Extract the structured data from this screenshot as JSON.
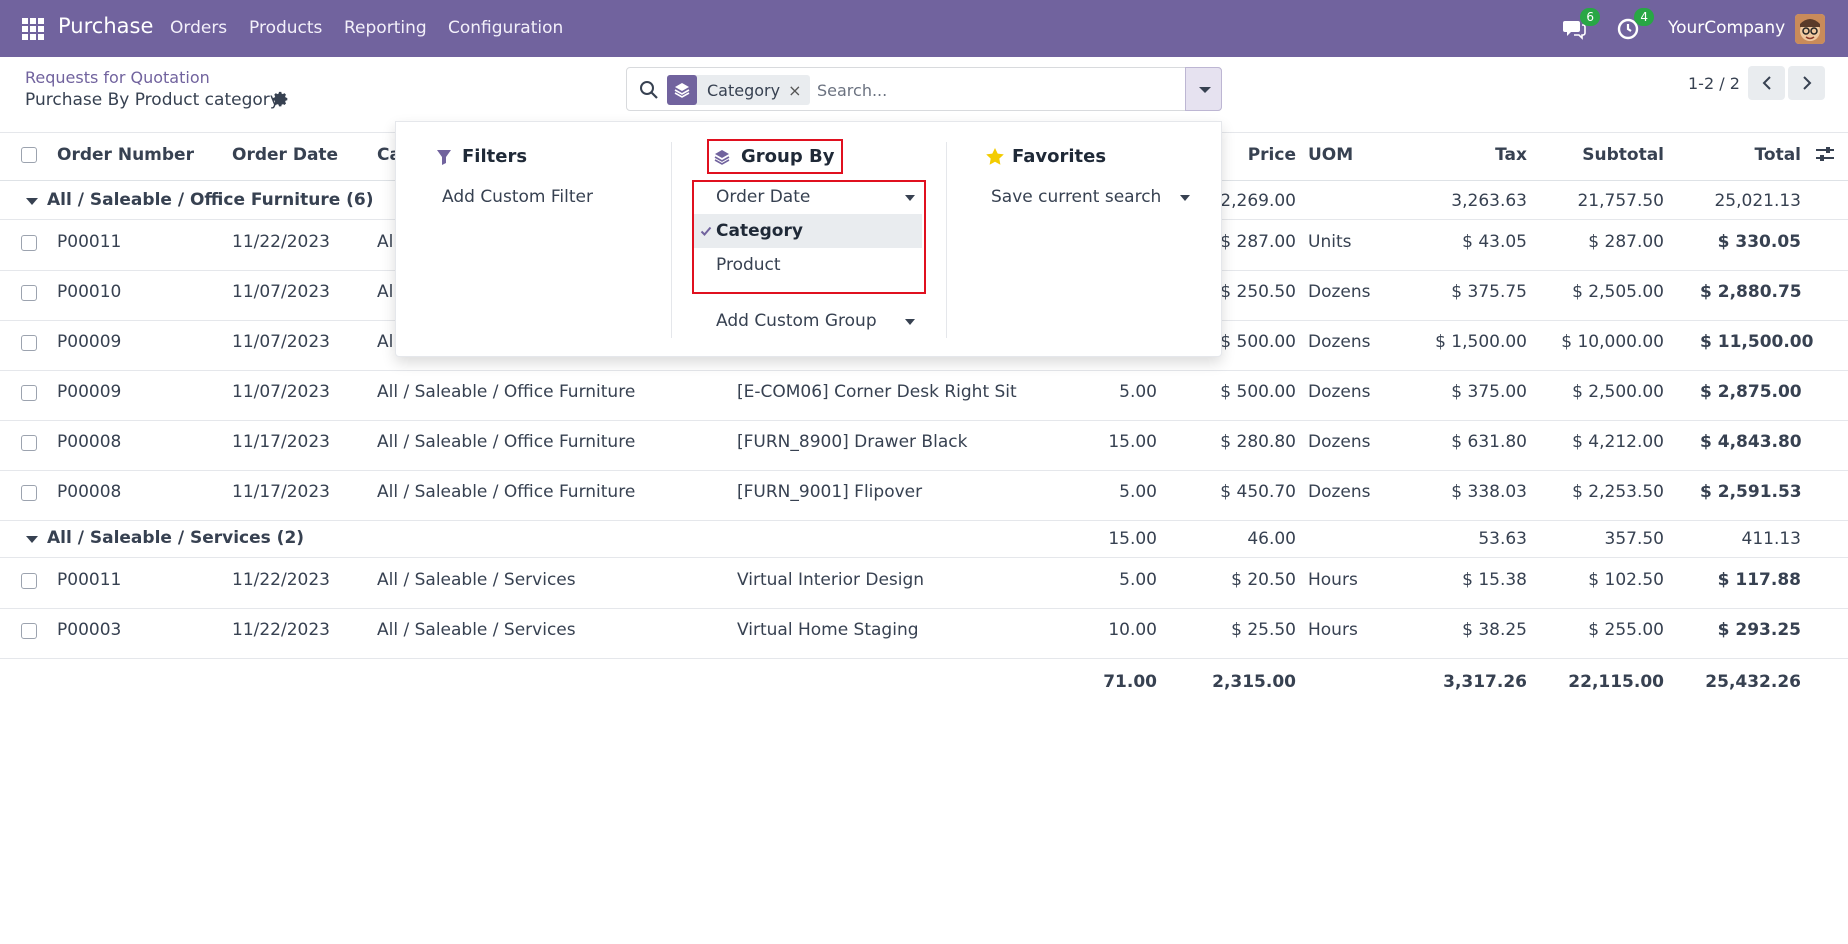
{
  "navbar": {
    "app_name": "Purchase",
    "menu": [
      "Orders",
      "Products",
      "Reporting",
      "Configuration"
    ],
    "messages_count": "6",
    "activities_count": "4",
    "company": "YourCompany",
    "icons": [
      "apps-grid-icon",
      "chat-icon",
      "clock-icon",
      "avatar"
    ]
  },
  "control_panel": {
    "breadcrumb": "Requests for Quotation",
    "title": "Purchase By Product category",
    "search": {
      "facet_label": "Category",
      "facet_close": "×",
      "placeholder": "Search..."
    },
    "pager": "1-2 / 2"
  },
  "dropdown": {
    "filters_title": "Filters",
    "add_custom_filter": "Add Custom Filter",
    "groupby_title": "Group By",
    "groupby_options": [
      "Order Date",
      "Category",
      "Product"
    ],
    "groupby_selected": "Category",
    "add_custom_group": "Add Custom Group",
    "favorites_title": "Favorites",
    "save_current_search": "Save current search"
  },
  "table": {
    "headers": {
      "order_number": "Order Number",
      "order_date": "Order Date",
      "category": "Ca",
      "price": "Price",
      "uom": "UOM",
      "tax": "Tax",
      "subtotal": "Subtotal",
      "total": "Total"
    },
    "groups": [
      {
        "label": "All / Saleable / Office Furniture (6)",
        "price": "2,269.00",
        "tax": "3,263.63",
        "subtotal": "21,757.50",
        "total": "25,021.13",
        "rows": [
          {
            "order": "P00011",
            "date": "11/22/2023",
            "category": "All",
            "product": "",
            "qty": "",
            "price": "$ 287.00",
            "uom": "Units",
            "tax": "$ 43.05",
            "subtotal": "$ 287.00",
            "total": "$ 330.05"
          },
          {
            "order": "P00010",
            "date": "11/07/2023",
            "category": "All",
            "product": "",
            "qty": "",
            "price": "$ 250.50",
            "uom": "Dozens",
            "tax": "$ 375.75",
            "subtotal": "$ 2,505.00",
            "total": "$ 2,880.75"
          },
          {
            "order": "P00009",
            "date": "11/07/2023",
            "category": "All",
            "product": "",
            "qty": "",
            "price": "$ 500.00",
            "uom": "Dozens",
            "tax": "$ 1,500.00",
            "subtotal": "$ 10,000.00",
            "total": "$ 11,500.00"
          },
          {
            "order": "P00009",
            "date": "11/07/2023",
            "category": "All / Saleable / Office Furniture",
            "product": "[E-COM06] Corner Desk Right Sit",
            "qty": "5.00",
            "price": "$ 500.00",
            "uom": "Dozens",
            "tax": "$ 375.00",
            "subtotal": "$ 2,500.00",
            "total": "$ 2,875.00"
          },
          {
            "order": "P00008",
            "date": "11/17/2023",
            "category": "All / Saleable / Office Furniture",
            "product": "[FURN_8900] Drawer Black",
            "qty": "15.00",
            "price": "$ 280.80",
            "uom": "Dozens",
            "tax": "$ 631.80",
            "subtotal": "$ 4,212.00",
            "total": "$ 4,843.80"
          },
          {
            "order": "P00008",
            "date": "11/17/2023",
            "category": "All / Saleable / Office Furniture",
            "product": "[FURN_9001] Flipover",
            "qty": "5.00",
            "price": "$ 450.70",
            "uom": "Dozens",
            "tax": "$ 338.03",
            "subtotal": "$ 2,253.50",
            "total": "$ 2,591.53"
          }
        ]
      },
      {
        "label": "All / Saleable / Services (2)",
        "qty": "15.00",
        "price": "46.00",
        "tax": "53.63",
        "subtotal": "357.50",
        "total": "411.13",
        "rows": [
          {
            "order": "P00011",
            "date": "11/22/2023",
            "category": "All / Saleable / Services",
            "product": "Virtual Interior Design",
            "qty": "5.00",
            "price": "$ 20.50",
            "uom": "Hours",
            "tax": "$ 15.38",
            "subtotal": "$ 102.50",
            "total": "$ 117.88"
          },
          {
            "order": "P00003",
            "date": "11/22/2023",
            "category": "All / Saleable / Services",
            "product": "Virtual Home Staging",
            "qty": "10.00",
            "price": "$ 25.50",
            "uom": "Hours",
            "tax": "$ 38.25",
            "subtotal": "$ 255.00",
            "total": "$ 293.25"
          }
        ]
      }
    ],
    "totals": {
      "qty": "71.00",
      "price": "2,315.00",
      "tax": "3,317.26",
      "subtotal": "22,115.00",
      "total": "25,432.26"
    }
  },
  "colors": {
    "brand": "#71639e",
    "highlight": "#e0101f",
    "badge": "#28a745"
  }
}
